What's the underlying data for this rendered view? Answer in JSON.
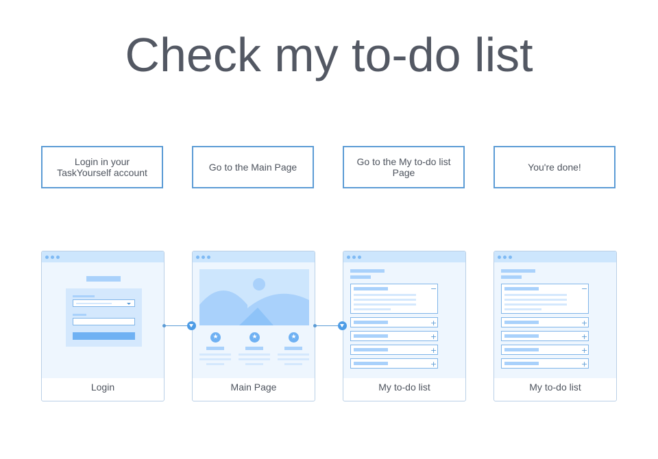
{
  "title": "Check my to-do list",
  "steps": [
    {
      "label": "Login in your TaskYourself account"
    },
    {
      "label": "Go to the Main Page"
    },
    {
      "label": "Go to the My to-do list Page"
    },
    {
      "label": "You're done!"
    }
  ],
  "screens": [
    {
      "label": "Login"
    },
    {
      "label": "Main Page"
    },
    {
      "label": "My to-do list"
    },
    {
      "label": "My to-do list"
    }
  ],
  "icons": {
    "collapse": "−",
    "expand": "+",
    "star": "★"
  },
  "colors": {
    "accent": "#5b9bd5",
    "card_bar": "#cde6fd",
    "card_body": "#eef6fe",
    "placeholder": "#a9d1fb"
  }
}
